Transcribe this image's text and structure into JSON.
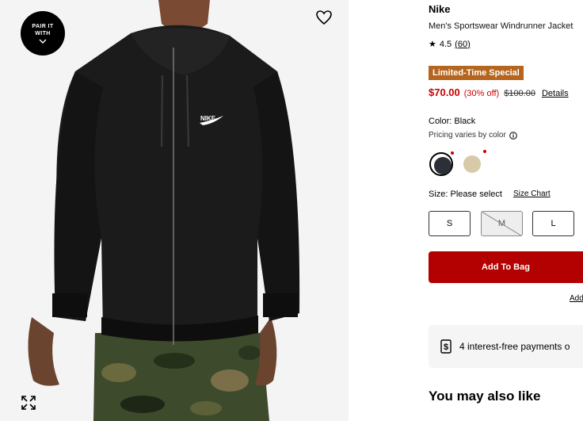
{
  "media": {
    "pair_with_label": "PAIR IT WITH",
    "favorite_icon": "heart-icon",
    "expand_icon": "expand-icon",
    "pair_icon": "chevron-down-icon"
  },
  "product": {
    "brand": "Nike",
    "name": "Men's Sportswear Windrunner Jacket",
    "rating": "4.5",
    "review_count": "(60)",
    "badge": "Limited-Time Special",
    "price": "$70.00",
    "discount": "(30% off)",
    "original_price": "$100.00",
    "details_link": "Details"
  },
  "color": {
    "label": "Color: Black",
    "pricing_note": "Pricing varies by color",
    "swatches": [
      {
        "name": "Black",
        "hex": "#2b2f38",
        "selected": true
      },
      {
        "name": "Tan",
        "hex": "#d8c9a8",
        "selected": false
      }
    ]
  },
  "size": {
    "label": "Size: Please select",
    "chart_link": "Size Chart",
    "options": [
      {
        "label": "S",
        "available": true
      },
      {
        "label": "M",
        "available": false
      },
      {
        "label": "L",
        "available": true
      }
    ]
  },
  "actions": {
    "add_to_bag": "Add To Bag",
    "add_link": "Add"
  },
  "installments": {
    "text": "4 interest-free payments o"
  },
  "recommendations": {
    "heading": "You may also like"
  },
  "colors": {
    "accent_red": "#b30000",
    "sale_red": "#cc0000",
    "badge_orange": "#b5651d"
  }
}
